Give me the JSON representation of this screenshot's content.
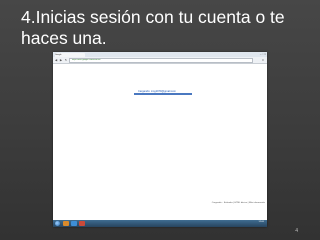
{
  "slide": {
    "title": "4.Inicias sesión con tu cuenta o te haces una.",
    "page_number": "4"
  },
  "browser": {
    "tab_title": "Google",
    "window_controls": "– ▫ ×",
    "address": "https://mail.google.com/mail/u/0/",
    "back_glyph": "◀",
    "forward_glyph": "▶",
    "reload_glyph": "↻",
    "menu_glyph": "≡"
  },
  "page": {
    "redirect_text": "Cargando: cmg1979@gmail.com",
    "footer_text": "Cargando... Estándar | HTML básico | Más información"
  },
  "taskbar": {
    "clock": "12:00"
  },
  "colors": {
    "slide_background": "#3b3b3b",
    "title_text": "#ffffff",
    "link_blue": "#1a55b0",
    "taskbar": "#2f5474"
  }
}
